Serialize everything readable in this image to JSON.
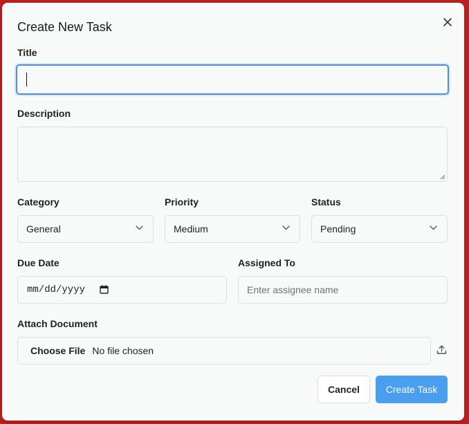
{
  "dialog": {
    "title": "Create New Task",
    "close_icon": "close-icon"
  },
  "form": {
    "title": {
      "label": "Title",
      "value": ""
    },
    "description": {
      "label": "Description",
      "value": ""
    },
    "category": {
      "label": "Category",
      "selected": "General"
    },
    "priority": {
      "label": "Priority",
      "selected": "Medium"
    },
    "status": {
      "label": "Status",
      "selected": "Pending"
    },
    "due_date": {
      "label": "Due Date",
      "value": "mm/dd/yyyy"
    },
    "assigned_to": {
      "label": "Assigned To",
      "placeholder": "Enter assignee name",
      "value": ""
    },
    "attachment": {
      "label": "Attach Document",
      "button_label": "Choose File",
      "status_text": "No file chosen"
    }
  },
  "actions": {
    "cancel_label": "Cancel",
    "create_label": "Create Task"
  },
  "colors": {
    "accent": "#4a9ef0",
    "focus_border": "#4a90e2",
    "backdrop": "#c41f1f",
    "dialog_bg": "#f8f9f9"
  }
}
